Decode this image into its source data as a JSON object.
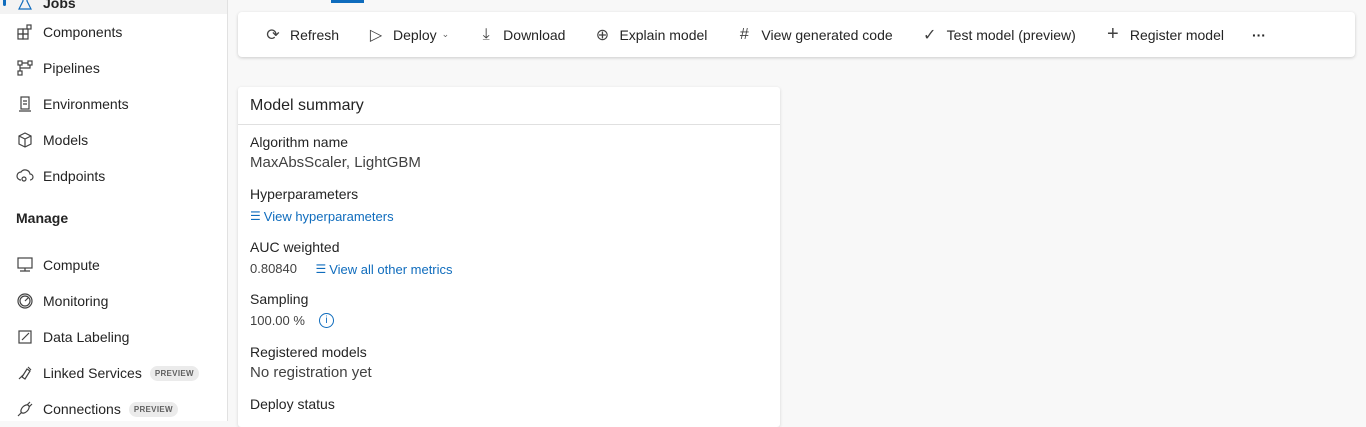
{
  "sidebar": {
    "selected_item": "Jobs",
    "items": [
      {
        "label": "Components",
        "icon": "components-icon"
      },
      {
        "label": "Pipelines",
        "icon": "pipelines-icon"
      },
      {
        "label": "Environments",
        "icon": "environments-icon"
      },
      {
        "label": "Models",
        "icon": "cube-icon"
      },
      {
        "label": "Endpoints",
        "icon": "endpoints-icon"
      }
    ],
    "manage_heading": "Manage",
    "manage_items": [
      {
        "label": "Compute",
        "icon": "monitor-icon"
      },
      {
        "label": "Monitoring",
        "icon": "gauge-icon"
      },
      {
        "label": "Data Labeling",
        "icon": "edit-icon"
      },
      {
        "label": "Linked Services",
        "icon": "link-icon",
        "badge": "PREVIEW"
      },
      {
        "label": "Connections",
        "icon": "plug-icon",
        "badge": "PREVIEW"
      }
    ]
  },
  "toolbar": {
    "refresh": "Refresh",
    "deploy": "Deploy",
    "download": "Download",
    "explain": "Explain model",
    "view_code": "View generated code",
    "test": "Test model (preview)",
    "register": "Register model",
    "more": "···"
  },
  "summary": {
    "title": "Model summary",
    "algorithm_label": "Algorithm name",
    "algorithm_value": "MaxAbsScaler, LightGBM",
    "hyper_label": "Hyperparameters",
    "hyper_link": "View hyperparameters",
    "auc_label": "AUC weighted",
    "auc_value": "0.80840",
    "metrics_link": "View all other metrics",
    "sampling_label": "Sampling",
    "sampling_value": "100.00 %",
    "registered_label": "Registered models",
    "registered_value": "No registration yet",
    "deploy_label": "Deploy status"
  },
  "colors": {
    "accent": "#0f6cbd"
  }
}
